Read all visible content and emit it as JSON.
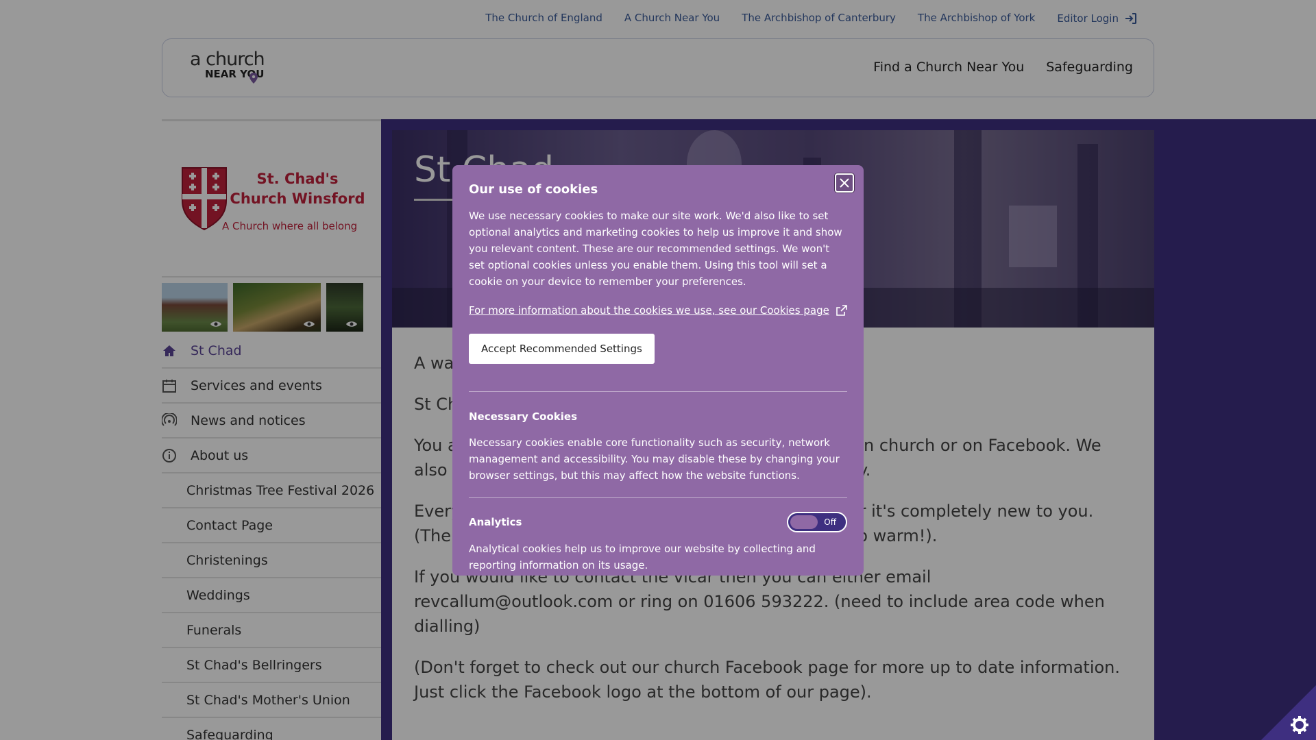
{
  "top_links": [
    "The Church of England",
    "A Church Near You",
    "The Archbishop of Canterbury",
    "The Archbishop of York"
  ],
  "editor_login": "Editor Login",
  "logo": {
    "line1": "a church",
    "line2": "NEAR YOU"
  },
  "main_nav": [
    "Find a Church Near You",
    "Safeguarding"
  ],
  "church": {
    "name": "St. Chad's Church Winsford",
    "tagline": "A Church where all belong"
  },
  "sidebar": {
    "items": [
      {
        "label": "St Chad"
      },
      {
        "label": "Services and events"
      },
      {
        "label": "News and notices"
      },
      {
        "label": "About us"
      },
      {
        "label": "Christmas Tree Festival 2026"
      },
      {
        "label": "Contact Page"
      },
      {
        "label": "Christenings"
      },
      {
        "label": "Weddings"
      },
      {
        "label": "Funerals"
      },
      {
        "label": "St Chad's Bellringers"
      },
      {
        "label": "St Chad's Mother's Union"
      },
      {
        "label": "Safeguarding"
      }
    ]
  },
  "hero": {
    "title": "St Chad"
  },
  "content": {
    "paragraphs": [
      "A warm welcome to St Chad's.",
      "St Chad's is a church where everyone belongs.",
      "You are welcome to join us on Sunday at 10am either in church or on Facebook. We also hold morning prayer and mid week on Wednesday.",
      "Everyone is welcome, whether you attend at church or it's completely new to you. (The church is heated, but in winter its best to wrap up warm!).",
      "If you would like to contact the vicar then you can either email revcallum@outlook.com or ring on 01606 593222. (need to include area code when dialling)",
      "(Don't forget to check out our church Facebook page for more up to date information. Just click the Facebook logo at the bottom of our page)."
    ]
  },
  "cookie": {
    "title": "Our use of cookies",
    "intro": "We use necessary cookies to make our site work. We'd also like to set optional analytics and marketing cookies to help us improve it and show you relevant content. These are our recommended settings. We won't set optional cookies unless you enable them. Using this tool will set a cookie on your device to remember your preferences.",
    "more_link": "For more information about the cookies we use, see our Cookies page",
    "accept_label": "Accept Recommended Settings",
    "necessary_title": "Necessary Cookies",
    "necessary_text": "Necessary cookies enable core functionality such as security, network management and accessibility. You may disable these by changing your browser settings, but this may affect how the website functions.",
    "analytics_title": "Analytics",
    "analytics_toggle": "Off",
    "analytics_text": "Analytical cookies help us to improve our website by collecting and reporting information on its usage."
  },
  "colors": {
    "purple": "#3e2f80",
    "modal": "#8f69a5",
    "brand_red": "#c0213b",
    "link": "#3a5a99"
  }
}
